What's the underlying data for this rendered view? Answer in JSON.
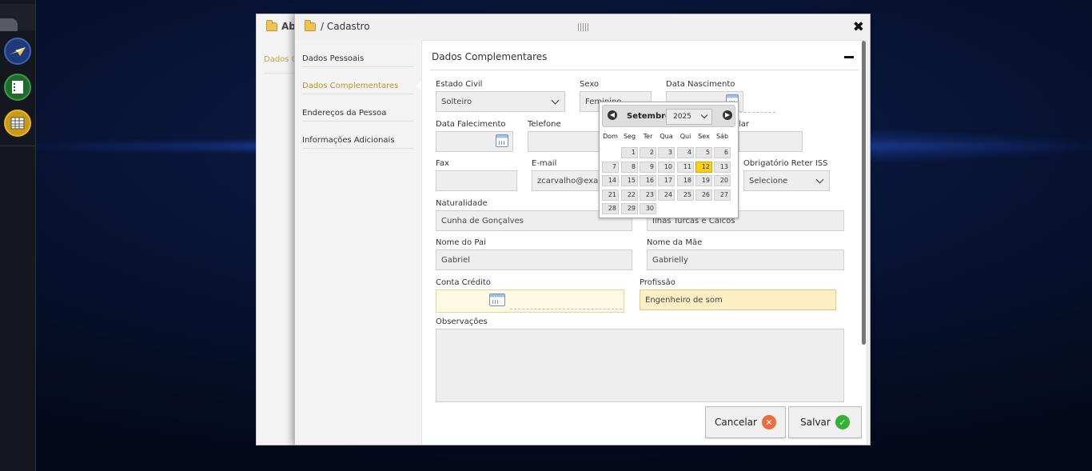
{
  "background_window": {
    "title": "Aba",
    "link": "Dados C"
  },
  "window": {
    "title": "/ Cadastro"
  },
  "sidebar": {
    "items": [
      {
        "label": "Dados Pessoais"
      },
      {
        "label": "Dados Complementares"
      },
      {
        "label": "Endereços da Pessoa"
      },
      {
        "label": "Informações Adicionais"
      }
    ]
  },
  "panel": {
    "title": "Dados Complementares"
  },
  "form": {
    "estado_civil": {
      "label": "Estado Civil",
      "value": "Solteiro"
    },
    "sexo": {
      "label": "Sexo",
      "value": "Feminino"
    },
    "data_nascimento": {
      "label": "Data Nascimento",
      "value": ""
    },
    "data_falecimento": {
      "label": "Data Falecimento",
      "value": ""
    },
    "telefone": {
      "label": "Telefone",
      "value": ""
    },
    "celular": {
      "label": "lar",
      "value": ""
    },
    "fax": {
      "label": "Fax",
      "value": ""
    },
    "email": {
      "label": "E-mail",
      "value": "zcarvalho@exam"
    },
    "reter_iss": {
      "label": "Obrigatório Reter ISS",
      "value": "Selecione"
    },
    "naturalidade": {
      "label": "Naturalidade",
      "value": "Cunha de Gonçalves"
    },
    "nacionalidade": {
      "value": "Ilhas Turcas e Caicos"
    },
    "nome_pai": {
      "label": "Nome do Pai",
      "value": "Gabriel"
    },
    "nome_mae": {
      "label": "Nome da Mãe",
      "value": "Gabrielly"
    },
    "conta_credito": {
      "label": "Conta Crédito",
      "value": ""
    },
    "profissao": {
      "label": "Profissão",
      "value": "Engenheiro de som"
    },
    "observacoes": {
      "label": "Observações",
      "value": ""
    }
  },
  "datepicker": {
    "month": "Setembro",
    "year": "2025",
    "prev": "◀",
    "next": "▶",
    "weekdays": [
      "Dom",
      "Seg",
      "Ter",
      "Qua",
      "Qui",
      "Sex",
      "Sáb"
    ],
    "selected_day": "12",
    "weeks": [
      [
        "",
        "1",
        "2",
        "3",
        "4",
        "5",
        "6"
      ],
      [
        "7",
        "8",
        "9",
        "10",
        "11",
        "12",
        "13"
      ],
      [
        "14",
        "15",
        "16",
        "17",
        "18",
        "19",
        "20"
      ],
      [
        "21",
        "22",
        "23",
        "24",
        "25",
        "26",
        "27"
      ],
      [
        "28",
        "29",
        "30",
        "",
        "",
        "",
        ""
      ]
    ]
  },
  "buttons": {
    "cancel": "Cancelar",
    "save": "Salvar",
    "close": "✖"
  },
  "colors": {
    "accent": "#c4912a",
    "today": "#f7d117",
    "cancel": "#ef6b3a",
    "save": "#34b233"
  }
}
